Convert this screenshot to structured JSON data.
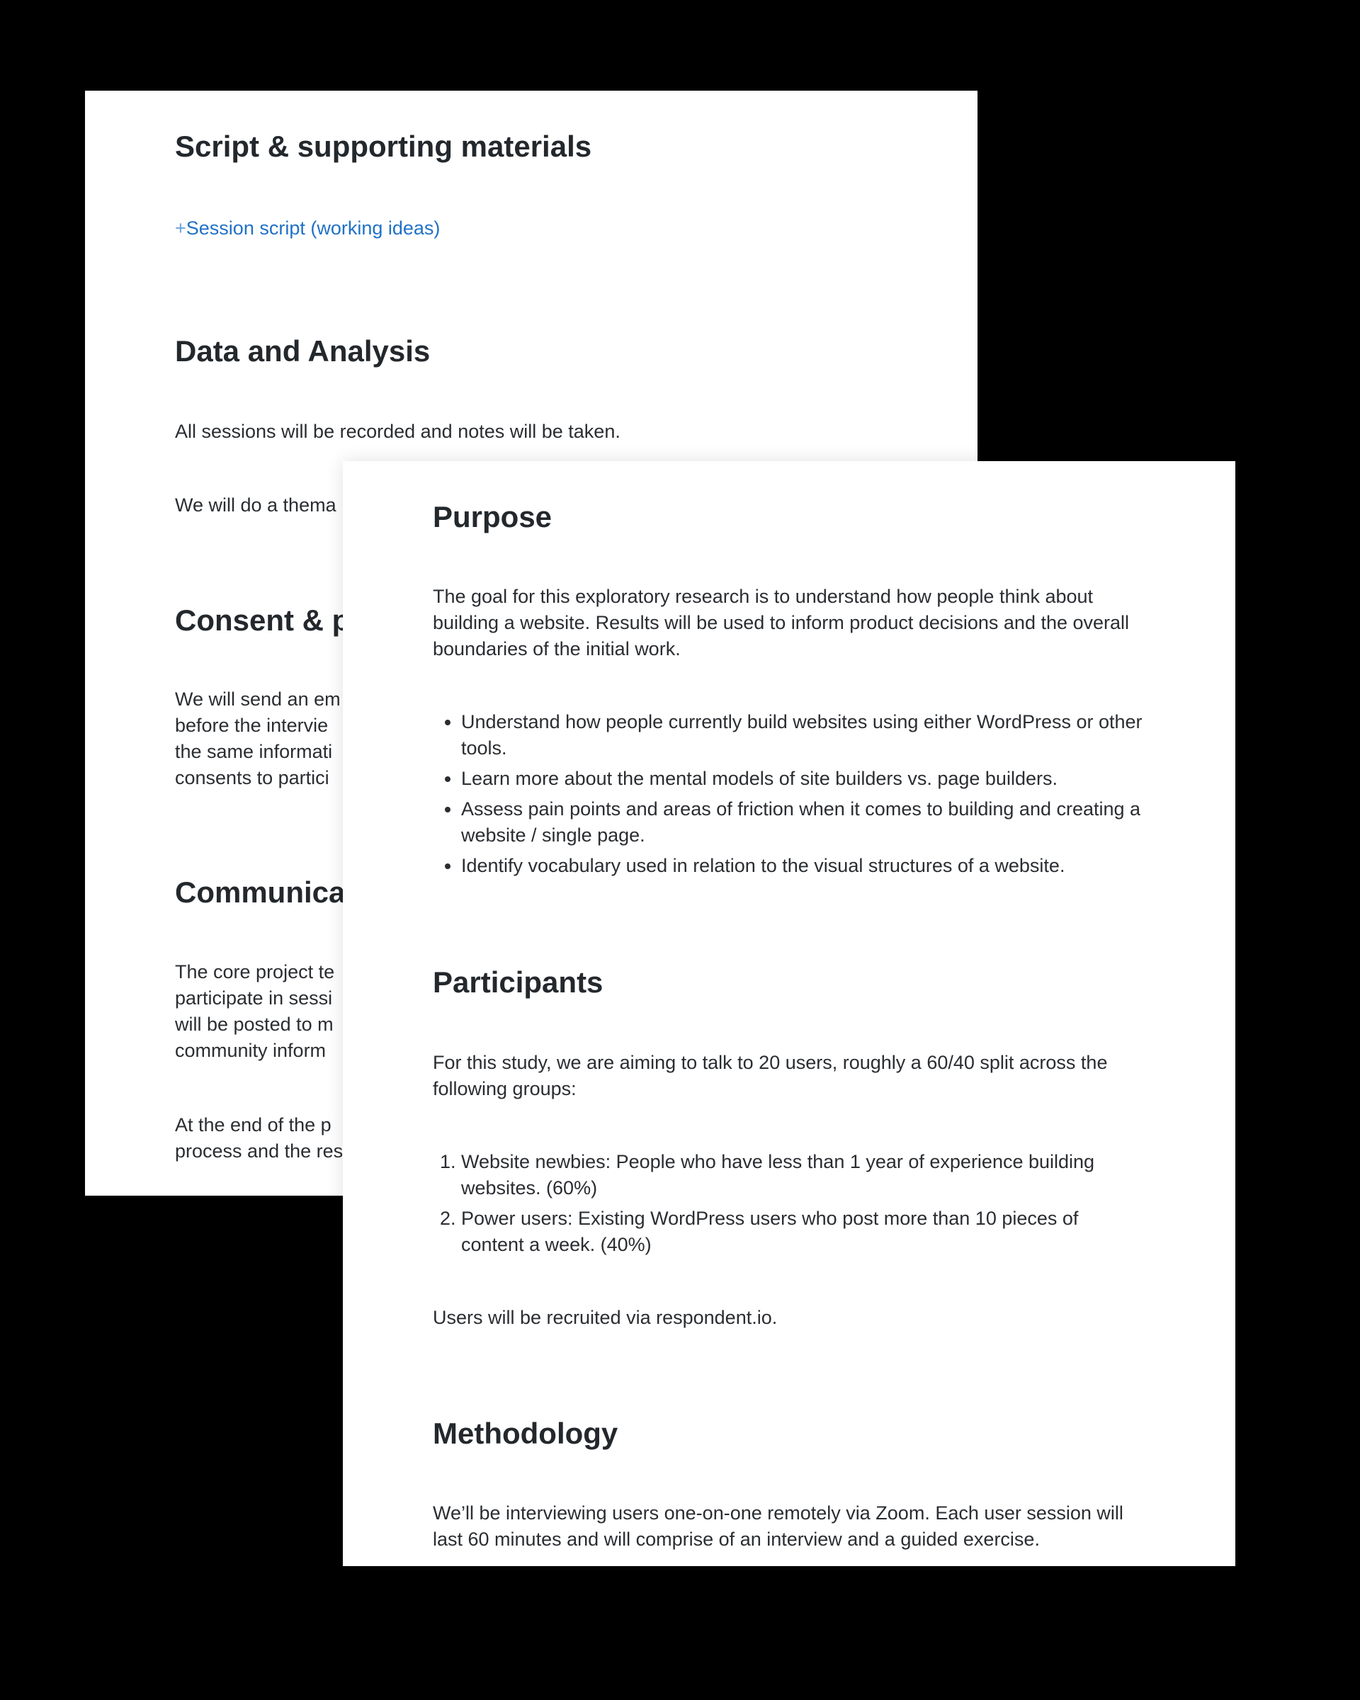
{
  "back_page": {
    "script_heading": "Script & supporting materials",
    "script_link": {
      "plus": "+",
      "label": "Session script (working ideas)"
    },
    "data_heading": "Data and Analysis",
    "data_paragraph_1": "All sessions will be recorded and notes will be taken.",
    "data_paragraph_2": "We will do a thema",
    "consent_heading": "Consent & p",
    "consent_lines": [
      "We will send an em",
      "before the intervie",
      "the same informati",
      "consents to partici"
    ],
    "comm_heading": "Communica",
    "comm_lines": [
      "The core project te",
      "participate in sessi",
      "will be posted to m",
      "community inform"
    ],
    "end_lines": [
      "At the end of the p",
      "process and the res"
    ]
  },
  "front_page": {
    "purpose_heading": "Purpose",
    "purpose_paragraph": "The goal for this exploratory research is to understand how people think about building a website. Results will be used to inform product decisions and the overall boundaries of the initial work.",
    "goals": [
      "Understand how people currently build websites using either WordPress or other tools.",
      "Learn more about the mental models of site builders vs. page builders.",
      "Assess pain points and areas of friction when it comes to building and creating a website / single page.",
      "Identify vocabulary used in relation to the visual structures of a website."
    ],
    "participants_heading": "Participants",
    "participants_paragraph": "For this study, we are aiming to talk to 20 users, roughly a 60/40 split across the following groups:",
    "groups": [
      "Website newbies: People who have less than 1 year of experience building websites. (60%)",
      "Power users: Existing WordPress users who post more than 10 pieces of content a week. (40%)"
    ],
    "recruit_paragraph": "Users will be recruited via respondent.io.",
    "methodology_heading": "Methodology",
    "methodology_paragraph": "We’ll be interviewing users one-on-one remotely via Zoom. Each user session will last 60 minutes and will comprise of an interview and a guided exercise."
  },
  "colors": {
    "background": "#000000",
    "page": "#ffffff",
    "text": "#2a2d31",
    "link": "#2171c7"
  }
}
